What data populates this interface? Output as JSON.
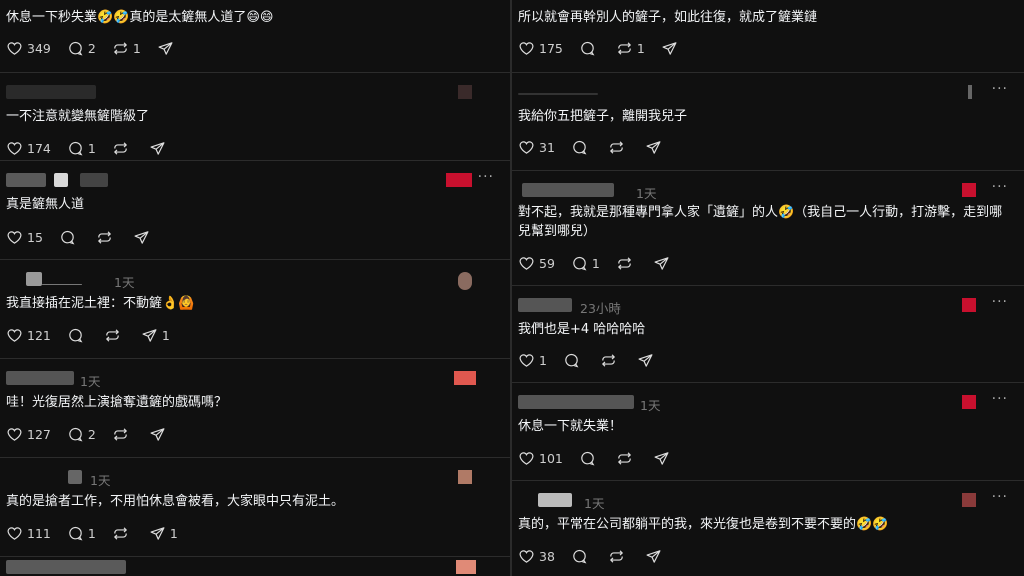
{
  "left": [
    {
      "text": "休息一下秒失業🤣🤣真的是太鏟無人道了😄😄",
      "likes": "349",
      "comments": "2",
      "reposts": "1",
      "shares": "",
      "age": ""
    },
    {
      "text": "一不注意就變無鏟階級了",
      "likes": "174",
      "comments": "1",
      "reposts": "",
      "shares": "",
      "age": ""
    },
    {
      "text": "真是鏟無人道",
      "likes": "15",
      "comments": "",
      "reposts": "",
      "shares": "",
      "age": ""
    },
    {
      "text": "我直接插在泥土裡：不動鏟👌🙆",
      "likes": "121",
      "comments": "",
      "reposts": "",
      "shares": "1",
      "age": "1天"
    },
    {
      "text": "哇！光復居然上演搶奪遺鏟的戲碼嗎？",
      "likes": "127",
      "comments": "2",
      "reposts": "",
      "shares": "",
      "age": "1天"
    },
    {
      "text": "真的是搶者工作，不用怕休息會被看，大家眼中只有泥土。",
      "likes": "111",
      "comments": "1",
      "reposts": "",
      "shares": "1",
      "age": "1天"
    }
  ],
  "right": [
    {
      "text": "所以就會再幹別人的鏟子，如此往復，就成了鏟業鏈",
      "likes": "175",
      "comments": "",
      "reposts": "1",
      "shares": "",
      "age": ""
    },
    {
      "text": "我給你五把鏟子，離開我兒子",
      "likes": "31",
      "comments": "",
      "reposts": "",
      "shares": "",
      "age": ""
    },
    {
      "text": "對不起，我就是那種專門拿人家「遺鏟」的人🤣（我自己一人行動，打游擊，走到哪兒幫到哪兒）",
      "likes": "59",
      "comments": "1",
      "reposts": "",
      "shares": "",
      "age": "1天"
    },
    {
      "text": "我們也是+4 哈哈哈哈",
      "likes": "1",
      "comments": "",
      "reposts": "",
      "shares": "",
      "age": "23小時"
    },
    {
      "text": "休息一下就失業！",
      "likes": "101",
      "comments": "",
      "reposts": "",
      "shares": "",
      "age": "1天"
    },
    {
      "text": "真的，平常在公司都躺平的我，來光復也是卷到不要不要的🤣🤣",
      "likes": "38",
      "comments": "",
      "reposts": "",
      "shares": "",
      "age": "1天"
    }
  ],
  "icons": {
    "like": "heart-icon",
    "comment": "comment-icon",
    "repost": "repost-icon",
    "share": "send-icon",
    "more": "more-icon"
  },
  "colors": {
    "background": "#101010",
    "text": "#f3f5f7",
    "muted": "#777777",
    "accent": "#c8102e"
  }
}
